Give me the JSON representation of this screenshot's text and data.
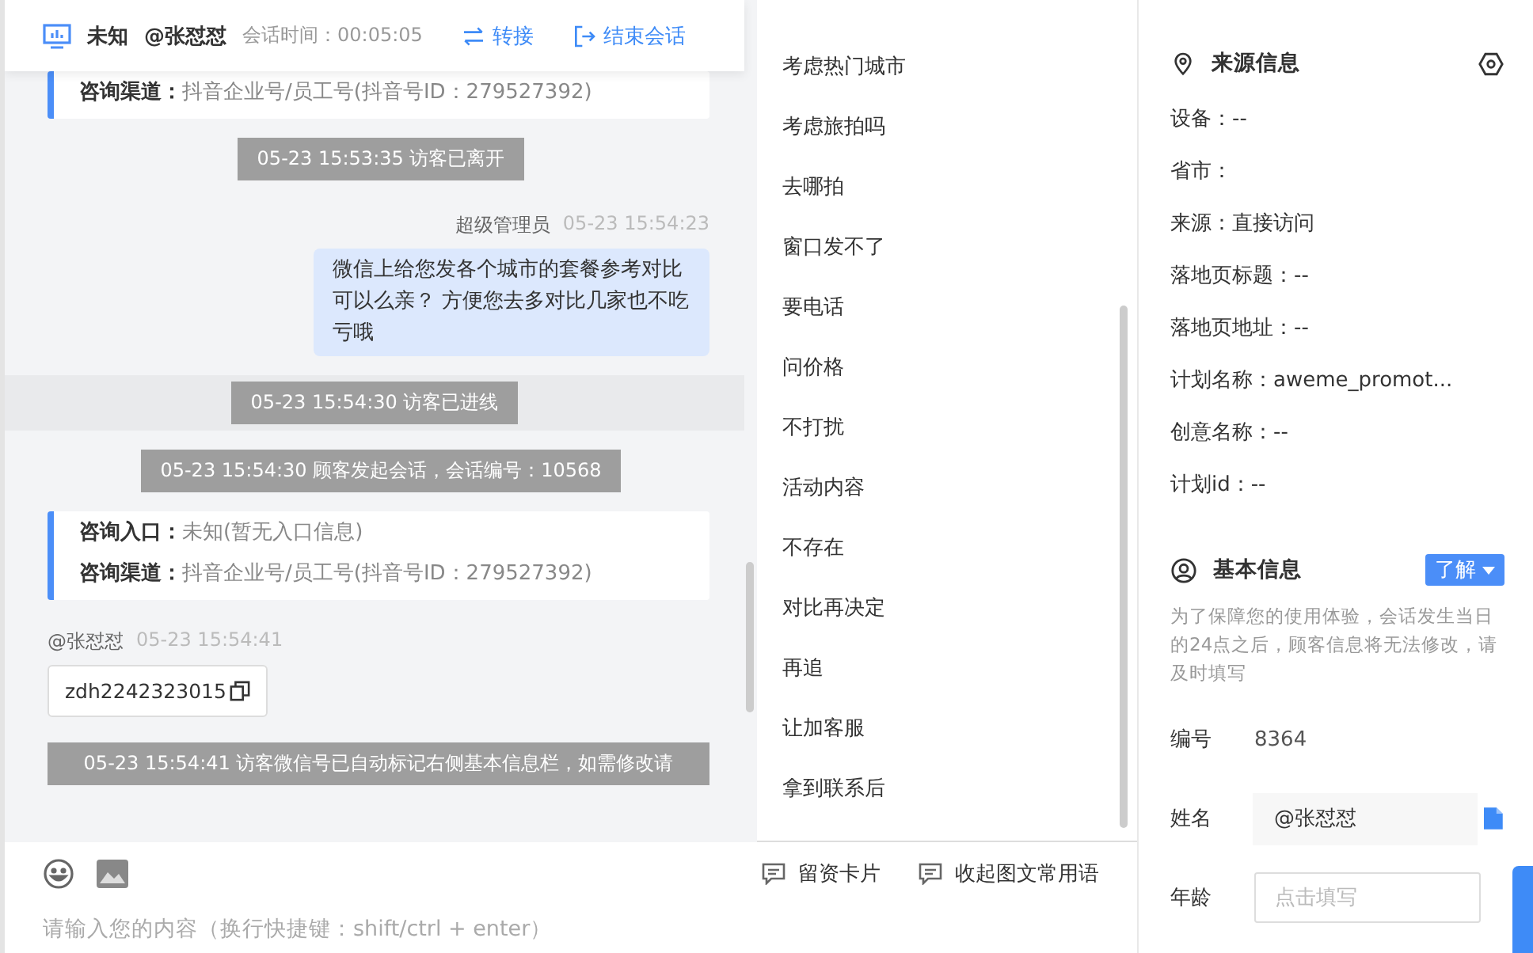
{
  "header": {
    "status": "未知",
    "visitor": "@张怼怼",
    "duration_label": "会话时间：00:05:05",
    "actions": [
      {
        "kind": "transfer",
        "label": "转接"
      },
      {
        "kind": "end",
        "label": "结束会话"
      }
    ]
  },
  "messages": [
    {
      "kind": "card",
      "rows": [
        {
          "label": "咨询渠道：",
          "value": "抖音企业号/员工号(抖音号ID：279527392)"
        }
      ]
    },
    {
      "kind": "system",
      "text": "05-23 15:53:35 访客已离开",
      "highlighted": false
    },
    {
      "kind": "agent",
      "sender": "超级管理员",
      "time": "05-23 15:54:23",
      "text": "微信上给您发各个城市的套餐参考对比可以么亲？ 方便您去多对比几家也不吃亏哦"
    },
    {
      "kind": "system",
      "text": "05-23 15:54:30 访客已进线",
      "highlighted": true
    },
    {
      "kind": "system",
      "text": "05-23 15:54:30 顾客发起会话，会话编号：10568",
      "highlighted": false
    },
    {
      "kind": "card",
      "rows": [
        {
          "label": "咨询入口：",
          "value": "未知(暂无入口信息)"
        },
        {
          "label": "咨询渠道：",
          "value": "抖音企业号/员工号(抖音号ID：279527392)"
        }
      ]
    },
    {
      "kind": "visitor",
      "sender": "@张怼怼",
      "time": "05-23 15:54:41",
      "text": "zdh2242323015"
    },
    {
      "kind": "banner",
      "text": "05-23 15:54:41 访客微信号已自动标记右侧基本信息栏，如需修改请"
    }
  ],
  "quick_replies": [
    "考虑热门城市",
    "考虑旅拍吗",
    "去哪拍",
    "窗口发不了",
    "要电话",
    "问价格",
    "不打扰",
    "活动内容",
    "不存在",
    "对比再决定",
    "再追",
    "让加客服",
    "拿到联系后"
  ],
  "composer": {
    "placeholder": "请输入您的内容（换行快捷键：shift/ctrl + enter）",
    "tools": [
      {
        "label": "留资卡片"
      },
      {
        "label": "收起图文常用语"
      }
    ]
  },
  "source_info": {
    "title": "来源信息",
    "fields": [
      "设备：--",
      "省市：",
      "来源：直接访问",
      "落地页标题：--",
      "落地页地址：--",
      "计划名称：aweme_promot...",
      "创意名称：--",
      "计划id：--"
    ]
  },
  "basic_info": {
    "title": "基本信息",
    "menu_label": "了解",
    "note": "为了保障您的使用体验，会话发生当日的24点之后，顾客信息将无法修改，请及时填写",
    "fields": [
      {
        "kind": "text",
        "label": "编号",
        "value": "8364"
      },
      {
        "kind": "readonly",
        "label": "姓名",
        "value": "@张怼怼"
      },
      {
        "kind": "input",
        "label": "年龄",
        "placeholder": "点击填写"
      }
    ]
  }
}
